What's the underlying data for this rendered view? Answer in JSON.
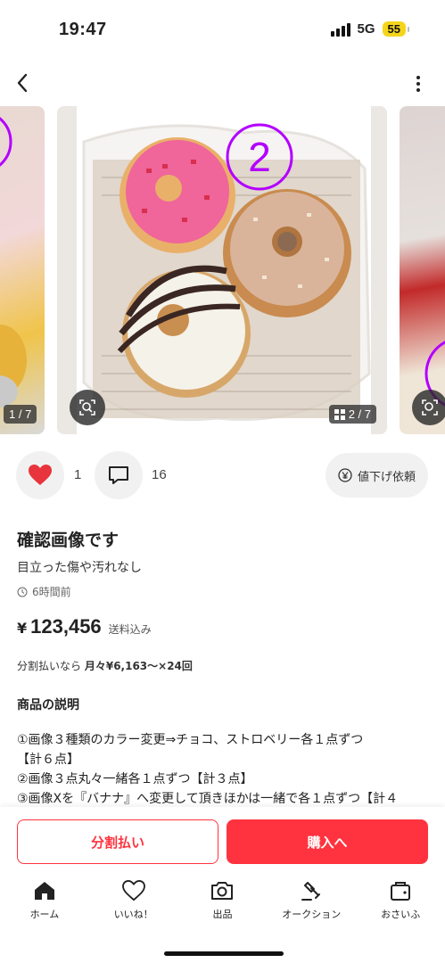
{
  "status_bar": {
    "time": "19:47",
    "network": "5G",
    "battery": "55"
  },
  "carousel": {
    "prev_counter": "1 / 7",
    "main_counter": "2 / 7",
    "overlay_number": "2"
  },
  "actions": {
    "like_count": "1",
    "comment_count": "16",
    "price_request_label": "値下げ依頼"
  },
  "item": {
    "title": "確認画像です",
    "condition": "目立った傷や汚れなし",
    "posted": "6時間前",
    "currency": "¥",
    "price": "123,456",
    "shipping": "送料込み",
    "installment_prefix": "分割払いなら",
    "installment_value": "月々¥6,163〜×24回",
    "description_title": "商品の説明",
    "description": "①画像３種類のカラー変更⇒チョコ、ストロベリー各１点ずつ\n【計６点】\n②画像３点丸々一緒各１点ずつ【計３点】\n③画像Xを『バナナ』へ変更して頂きほかは一緒で各１点ずつ【計４"
  },
  "cta": {
    "split_label": "分割払い",
    "buy_label": "購入へ"
  },
  "tabs": [
    {
      "label": "ホーム",
      "icon": "home-icon"
    },
    {
      "label": "いいね！",
      "icon": "heart-icon"
    },
    {
      "label": "出品",
      "icon": "camera-icon"
    },
    {
      "label": "オークション",
      "icon": "gavel-icon"
    },
    {
      "label": "おさいふ",
      "icon": "wallet-icon"
    }
  ],
  "colors": {
    "accent": "#ff333f",
    "like": "#e8343c",
    "battery": "#f4d51b",
    "annotation": "#b300ff"
  }
}
